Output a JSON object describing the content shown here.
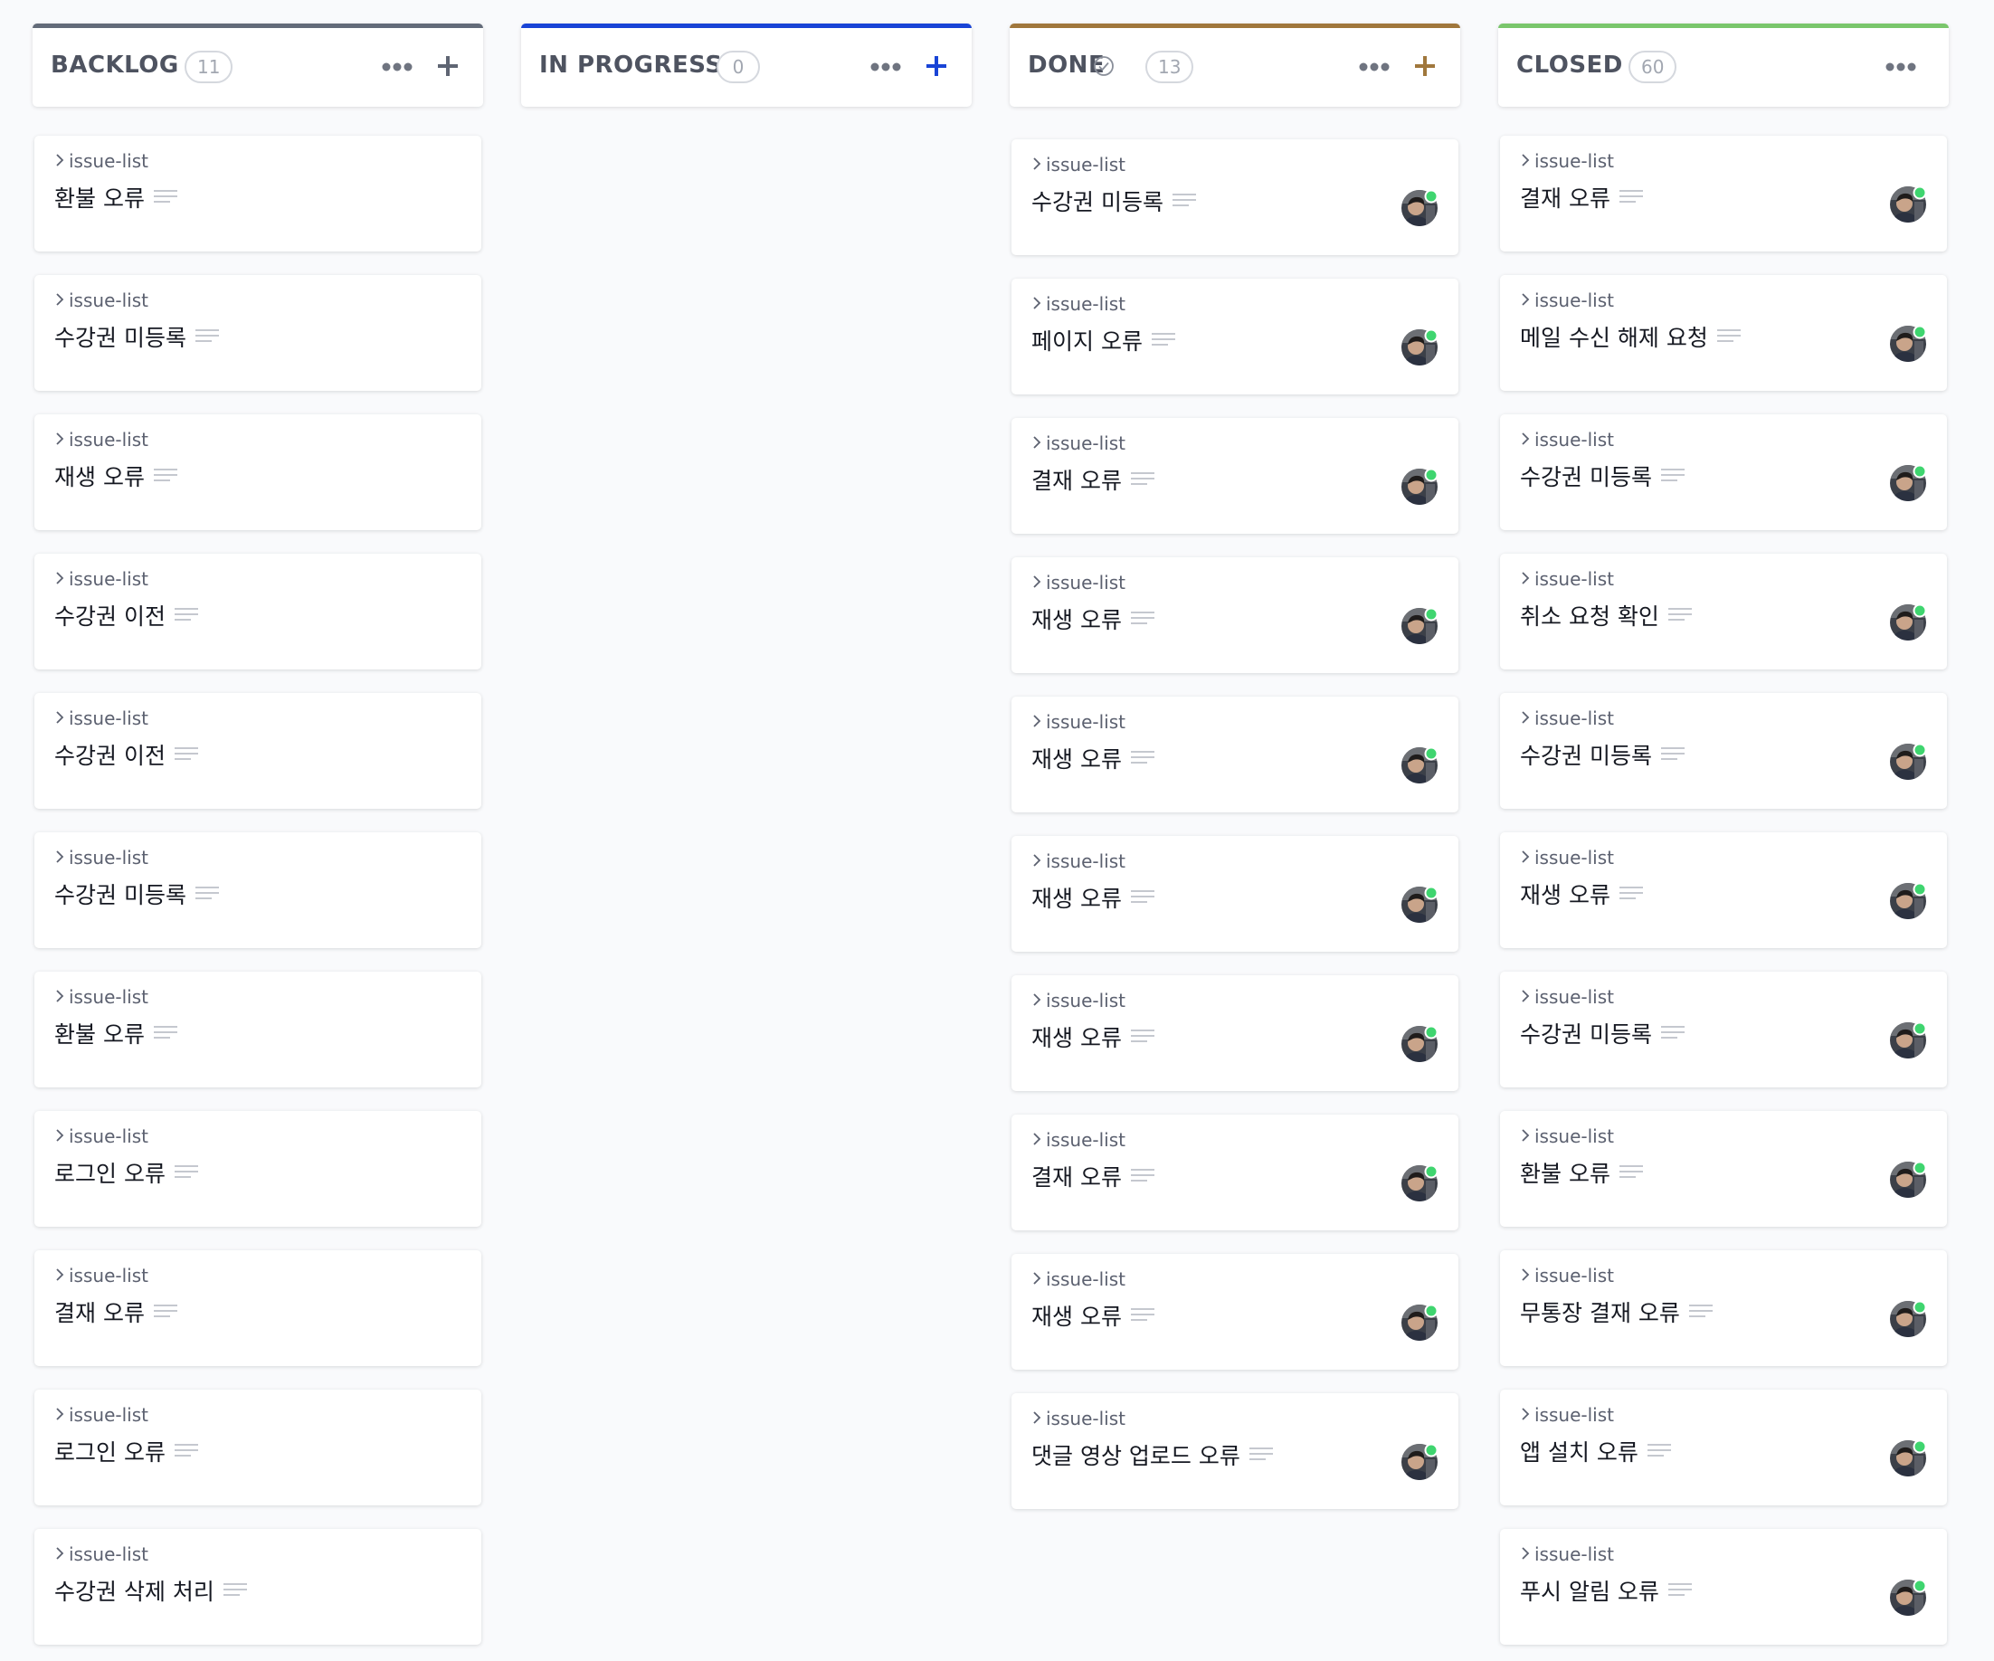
{
  "colors": {
    "backlog": "#636b79",
    "in_progress": "#1944d6",
    "done": "#a0773c",
    "closed": "#7ac66c",
    "online": "#3fd56f"
  },
  "columns": [
    {
      "key": "backlog",
      "title": "BACKLOG",
      "count": "11",
      "show_check": false,
      "has_add": true,
      "cards": [
        {
          "list": "issue-list",
          "title": "환불 오류",
          "avatar": false
        },
        {
          "list": "issue-list",
          "title": "수강권 미등록",
          "avatar": false
        },
        {
          "list": "issue-list",
          "title": "재생 오류",
          "avatar": false
        },
        {
          "list": "issue-list",
          "title": "수강권 이전",
          "avatar": false
        },
        {
          "list": "issue-list",
          "title": "수강권 이전",
          "avatar": false
        },
        {
          "list": "issue-list",
          "title": "수강권 미등록",
          "avatar": false
        },
        {
          "list": "issue-list",
          "title": "환불 오류",
          "avatar": false
        },
        {
          "list": "issue-list",
          "title": "로그인 오류",
          "avatar": false
        },
        {
          "list": "issue-list",
          "title": "결재 오류",
          "avatar": false
        },
        {
          "list": "issue-list",
          "title": "로그인 오류",
          "avatar": false
        },
        {
          "list": "issue-list",
          "title": "수강권 삭제 처리",
          "avatar": false
        }
      ]
    },
    {
      "key": "in_progress",
      "title": "IN PROGRESS",
      "count": "0",
      "show_check": false,
      "has_add": true,
      "cards": []
    },
    {
      "key": "done",
      "title": "DONE",
      "count": "13",
      "show_check": true,
      "has_add": true,
      "cards": [
        {
          "list": "issue-list",
          "title": "수강권 미등록",
          "avatar": true
        },
        {
          "list": "issue-list",
          "title": "페이지 오류",
          "avatar": true
        },
        {
          "list": "issue-list",
          "title": "결재 오류",
          "avatar": true
        },
        {
          "list": "issue-list",
          "title": "재생 오류",
          "avatar": true
        },
        {
          "list": "issue-list",
          "title": "재생 오류",
          "avatar": true
        },
        {
          "list": "issue-list",
          "title": "재생 오류",
          "avatar": true
        },
        {
          "list": "issue-list",
          "title": "재생 오류",
          "avatar": true
        },
        {
          "list": "issue-list",
          "title": "결재 오류",
          "avatar": true
        },
        {
          "list": "issue-list",
          "title": "재생 오류",
          "avatar": true
        },
        {
          "list": "issue-list",
          "title": "댓글 영상 업로드 오류",
          "avatar": true
        }
      ]
    },
    {
      "key": "closed",
      "title": "CLOSED",
      "count": "60",
      "show_check": false,
      "has_add": false,
      "cards": [
        {
          "list": "issue-list",
          "title": "결재 오류",
          "avatar": true
        },
        {
          "list": "issue-list",
          "title": "메일 수신 해제 요청",
          "avatar": true
        },
        {
          "list": "issue-list",
          "title": "수강권 미등록",
          "avatar": true
        },
        {
          "list": "issue-list",
          "title": "취소 요청 확인",
          "avatar": true
        },
        {
          "list": "issue-list",
          "title": "수강권 미등록",
          "avatar": true
        },
        {
          "list": "issue-list",
          "title": "재생 오류",
          "avatar": true
        },
        {
          "list": "issue-list",
          "title": "수강권 미등록",
          "avatar": true
        },
        {
          "list": "issue-list",
          "title": "환불 오류",
          "avatar": true
        },
        {
          "list": "issue-list",
          "title": "무통장 결재 오류",
          "avatar": true
        },
        {
          "list": "issue-list",
          "title": "앱 설치 오류",
          "avatar": true
        },
        {
          "list": "issue-list",
          "title": "푸시 알림 오류",
          "avatar": true
        }
      ]
    }
  ]
}
